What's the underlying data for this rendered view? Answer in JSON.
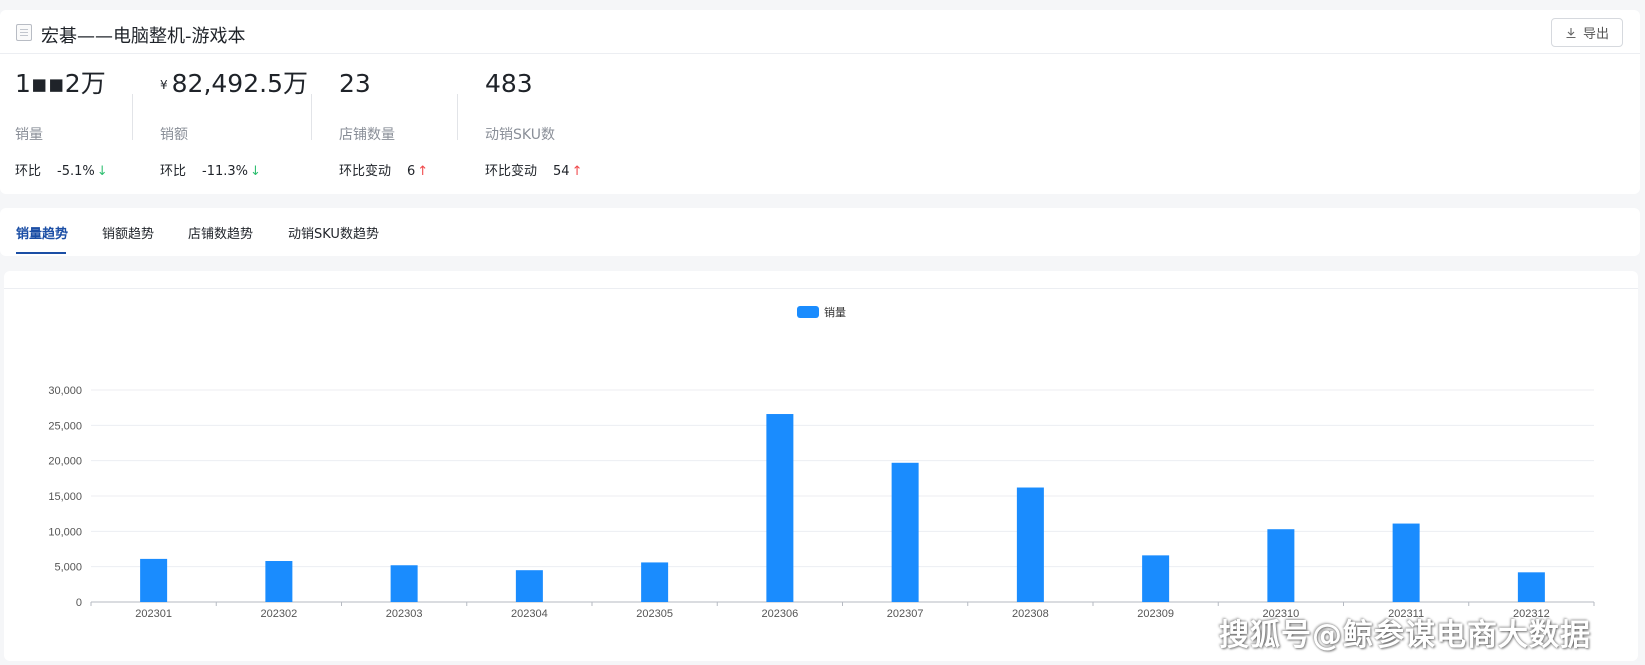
{
  "header": {
    "title": "宏碁——电脑整机-游戏本",
    "export_label": "导出"
  },
  "metrics": [
    {
      "value": "1▪▪2万",
      "currency": "",
      "label": "销量",
      "compare_label": "环比",
      "compare_value": "-5.1%",
      "direction": "down"
    },
    {
      "value": "82,492.5万",
      "currency": "¥",
      "label": "销额",
      "compare_label": "环比",
      "compare_value": "-11.3%",
      "direction": "down"
    },
    {
      "value": "23",
      "currency": "",
      "label": "店铺数量",
      "compare_label": "环比变动",
      "compare_value": "6",
      "direction": "up"
    },
    {
      "value": "483",
      "currency": "",
      "label": "动销SKU数",
      "compare_label": "环比变动",
      "compare_value": "54",
      "direction": "up"
    }
  ],
  "tabs": [
    {
      "label": "销量趋势",
      "active": true
    },
    {
      "label": "销额趋势",
      "active": false
    },
    {
      "label": "店铺数趋势",
      "active": false
    },
    {
      "label": "动销SKU数趋势",
      "active": false
    }
  ],
  "arrows": {
    "up": "↑",
    "down": "↓"
  },
  "colors": {
    "bar": "#1a8cfe",
    "accent": "#1b4ea5",
    "up": "#f0484a",
    "down": "#2fbf71"
  },
  "watermark": "搜狐号@鲸参谋电商大数据",
  "chart_data": {
    "type": "bar",
    "legend": "销量",
    "legend_position": "top-center",
    "categories": [
      "202301",
      "202302",
      "202303",
      "202304",
      "202305",
      "202306",
      "202307",
      "202308",
      "202309",
      "202310",
      "202311",
      "202312"
    ],
    "series": [
      {
        "name": "销量",
        "values": [
          6100,
          5800,
          5200,
          4500,
          5600,
          26600,
          19700,
          16200,
          6600,
          10300,
          11100,
          4200
        ]
      }
    ],
    "yticks": [
      "0",
      "5,000",
      "10,000",
      "15,000",
      "20,000",
      "25,000",
      "30,000"
    ],
    "ylim": [
      0,
      30000
    ],
    "grid": true
  }
}
